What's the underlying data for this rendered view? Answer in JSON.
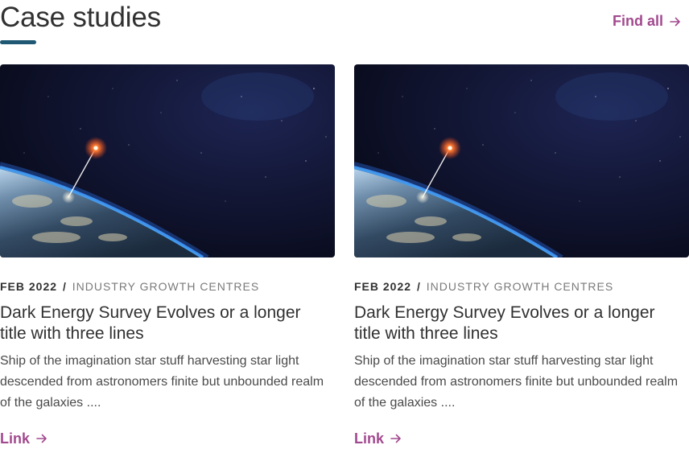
{
  "header": {
    "title": "Case studies",
    "find_all_label": "Find all"
  },
  "colors": {
    "accent": "#a24a8f",
    "underline": "#1e5873",
    "text": "#313131",
    "muted": "#7a7a7a"
  },
  "cards": [
    {
      "date": "FEB 2022",
      "separator": "/",
      "category": "INDUSTRY GROWTH CENTRES",
      "title": "Dark Energy Survey Evolves or a longer title with three lines",
      "description": "Ship of the imagination star stuff harvesting star light descended from astronomers finite but unbounded realm of the galaxies ....",
      "link_label": "Link",
      "image_icon": "earth-from-space-image"
    },
    {
      "date": "FEB 2022",
      "separator": "/",
      "category": "INDUSTRY GROWTH CENTRES",
      "title": "Dark Energy Survey Evolves or a longer title with three lines",
      "description": "Ship of the imagination star stuff harvesting star light descended from astronomers finite but unbounded realm of the galaxies ....",
      "link_label": "Link",
      "image_icon": "earth-from-space-image"
    }
  ]
}
